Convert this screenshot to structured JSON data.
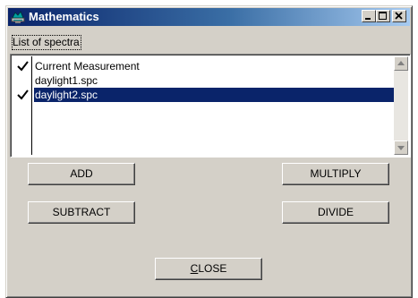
{
  "window": {
    "title": "Mathematics",
    "icon": "app-icon",
    "controls": {
      "minimize": "minimize-icon",
      "maximize": "maximize-icon",
      "close": "close-icon"
    }
  },
  "list": {
    "caption": "List of spectra",
    "items": [
      {
        "label": "Current Measurement",
        "checked": true,
        "selected": false
      },
      {
        "label": "daylight1.spc",
        "checked": false,
        "selected": false
      },
      {
        "label": "daylight2.spc",
        "checked": true,
        "selected": true
      }
    ],
    "selection_color": "#0a246a"
  },
  "buttons": {
    "add": "ADD",
    "multiply": "MULTIPLY",
    "subtract": "SUBTRACT",
    "divide": "DIVIDE",
    "close_first": "C",
    "close_rest": "LOSE"
  },
  "colors": {
    "face": "#d4d0c8",
    "title_start": "#0a246a",
    "title_end": "#a6caf0"
  }
}
